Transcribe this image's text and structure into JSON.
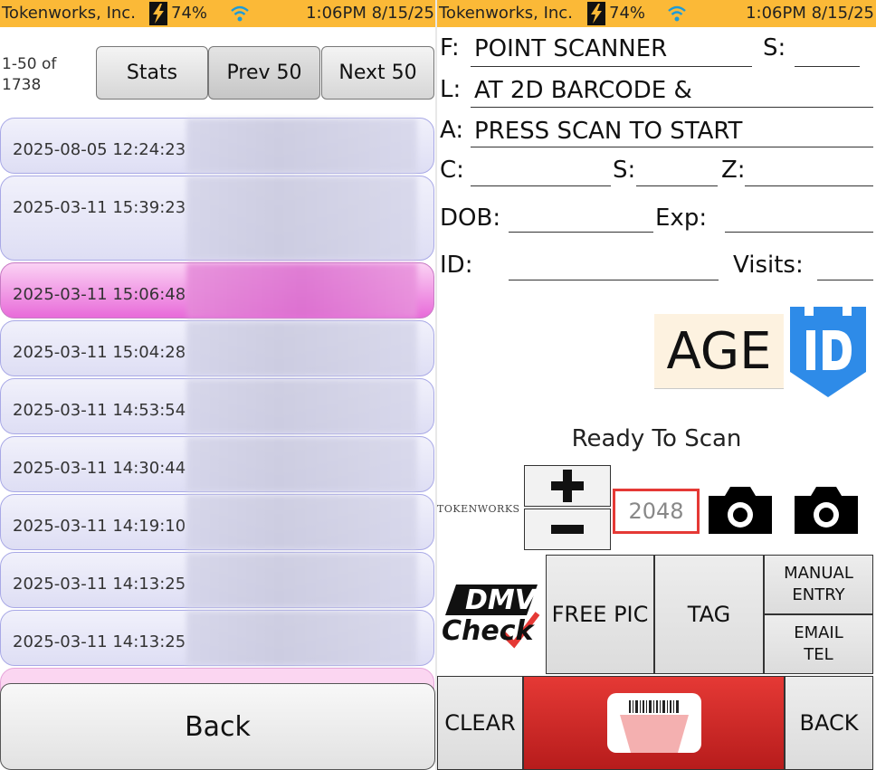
{
  "status_bar": {
    "title": "Tokenworks, Inc.",
    "battery": "74%",
    "time": "1:06PM 8/15/25"
  },
  "left": {
    "count_label_line1": "1-50 of",
    "count_label_line2": "1738",
    "stats_label": "Stats",
    "prev_label": "Prev 50",
    "next_label": "Next 50",
    "rows": [
      {
        "timestamp": "2025-08-05 12:24:23"
      },
      {
        "timestamp": "2025-03-11 15:39:23"
      },
      {
        "timestamp": "2025-03-11 15:06:48"
      },
      {
        "timestamp": "2025-03-11 15:04:28"
      },
      {
        "timestamp": "2025-03-11 14:53:54"
      },
      {
        "timestamp": "2025-03-11 14:30:44"
      },
      {
        "timestamp": "2025-03-11 14:19:10"
      },
      {
        "timestamp": "2025-03-11 14:13:25"
      },
      {
        "timestamp": "2025-03-11 14:13:25"
      }
    ],
    "back_label": "Back"
  },
  "right": {
    "labels": {
      "first": "F:",
      "sex": "S:",
      "last": "L:",
      "address": "A:",
      "city": "C:",
      "state": "S:",
      "zip": "Z:",
      "dob": "DOB:",
      "exp": "Exp:",
      "id": "ID:",
      "visits": "Visits:"
    },
    "values": {
      "first": "POINT SCANNER",
      "last": "AT 2D BARCODE &",
      "address": "PRESS SCAN TO START"
    },
    "age_text": "AGE",
    "ready_text": "Ready To Scan",
    "tokenworks_text": "TOKENWORKS",
    "zoom_value": "2048",
    "dmv_line1": "DMV",
    "dmv_line2": "Check",
    "free_pic_label": "FREE PIC",
    "tag_label": "TAG",
    "manual_entry_label": [
      "MANUAL",
      "ENTRY"
    ],
    "email_tel_label": [
      "EMAIL",
      "TEL"
    ],
    "clear_label": "CLEAR",
    "back_label": "BACK"
  },
  "colors": {
    "status_bar": "#fbb937",
    "row_normal": "#e4e4f6",
    "row_selected": "#e86bd9",
    "scan_button": "#c62828",
    "zoom_border": "#e53935",
    "logo_blue": "#2e8be8"
  }
}
